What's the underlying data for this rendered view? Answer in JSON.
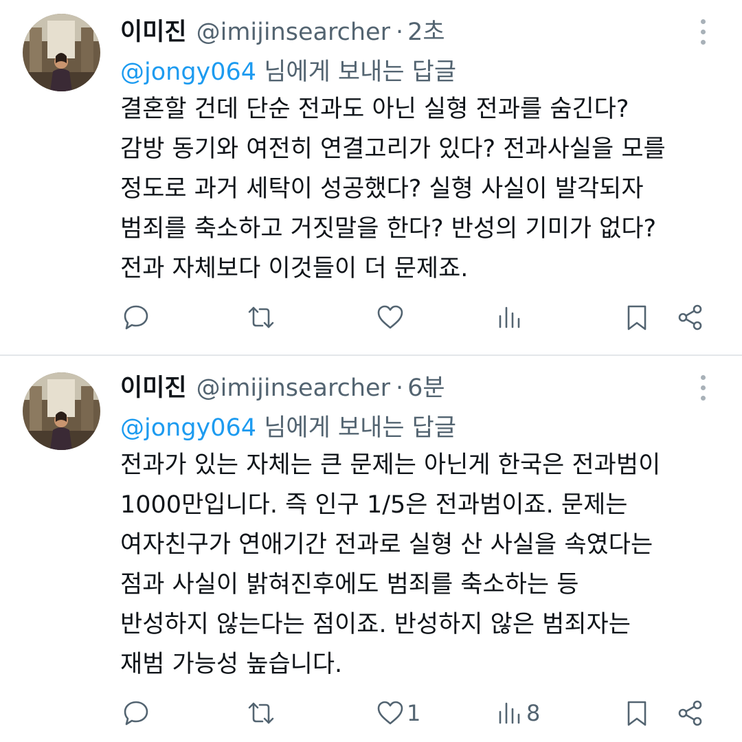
{
  "tweets": [
    {
      "name": "이미진",
      "handle": "@imijinsearcher",
      "separator": "·",
      "time": "2초",
      "reply_mention": "@jongy064",
      "reply_suffix": " 님에게 보내는 답글",
      "body_lines": [
        "결혼할 건데 단순 전과도 아닌 실형 전과를 숨긴다?",
        "감방 동기와 여전히 연결고리가 있다? 전과사실을 모를",
        "정도로 과거 세탁이 성공했다? 실형 사실이 발각되자",
        "범죄를 축소하고 거짓말을 한다? 반성의 기미가 없다?",
        "전과 자체보다 이것들이 더 문제죠."
      ],
      "likes": "",
      "views": ""
    },
    {
      "name": "이미진",
      "handle": "@imijinsearcher",
      "separator": "·",
      "time": "6분",
      "reply_mention": "@jongy064",
      "reply_suffix": " 님에게 보내는 답글",
      "body_lines": [
        "전과가 있는 자체는 큰 문제는 아닌게 한국은 전과범이",
        "1000만입니다. 즉 인구 1/5은 전과범이죠. 문제는",
        "여자친구가 연애기간 전과로 실형 산 사실을 속였다는",
        "점과 사실이 밝혀진후에도 범죄를 축소하는 등",
        "반성하지 않는다는 점이죠. 반성하지 않은 범죄자는",
        "재범 가능성 높습니다."
      ],
      "likes": "1",
      "views": "8"
    }
  ],
  "icons": [
    "reply-icon",
    "retweet-icon",
    "like-icon",
    "views-icon",
    "bookmark-icon",
    "share-icon",
    "more-icon"
  ],
  "colors": {
    "text": "#0f1419",
    "secondary": "#536471",
    "link": "#1d9bf0",
    "divider": "#e3e6e9"
  }
}
